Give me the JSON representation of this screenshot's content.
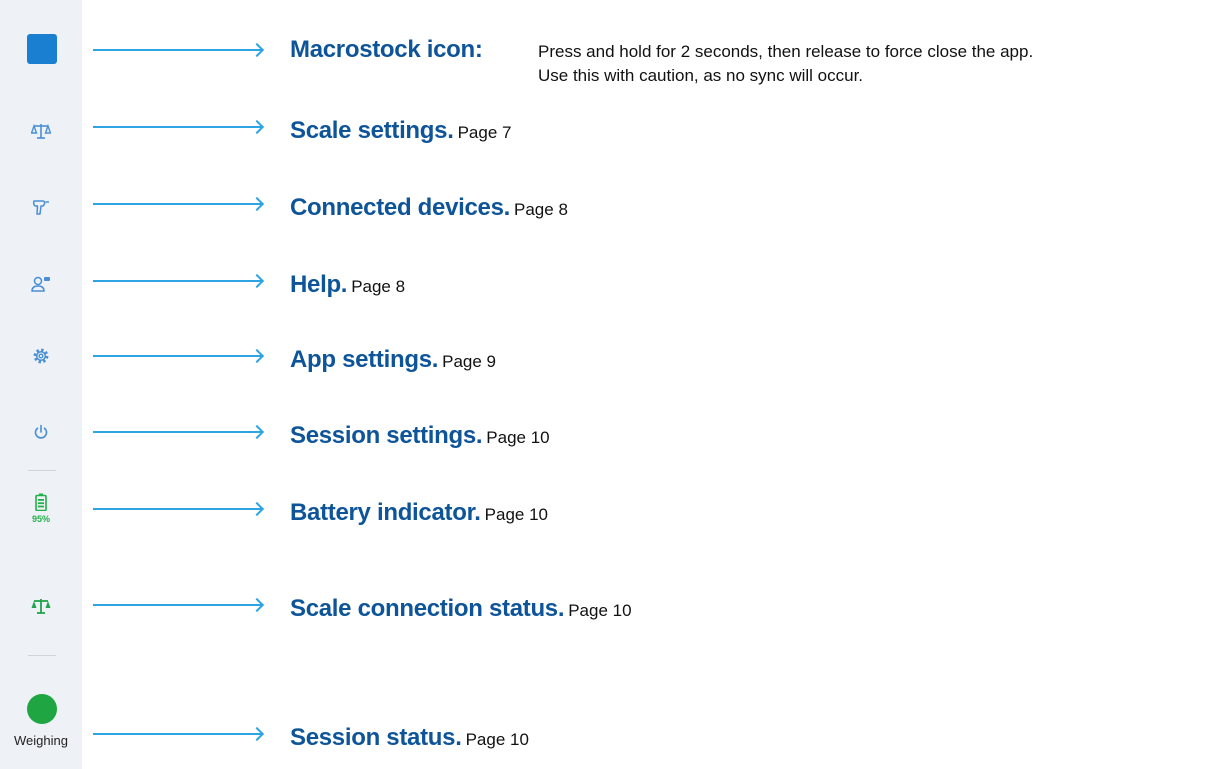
{
  "sidebar": {
    "battery_percent": "95%",
    "status_label": "Weighing",
    "icons": [
      "macrostock-icon",
      "scale-icon",
      "scanner-icon",
      "help-icon",
      "gear-icon",
      "power-icon",
      "battery-icon",
      "scale-status-icon",
      "status-dot-icon"
    ],
    "colors": {
      "background": "#eef1f5",
      "accent_blue": "#1a7fd1",
      "icon_blue": "#4a8fd6",
      "status_green": "#1fa541"
    }
  },
  "callouts": {
    "macrostock": {
      "title": "Macrostock icon:",
      "desc_line1": "Press and hold for 2 seconds, then release to force close the app.",
      "desc_line2": "Use this with caution, as no sync will occur."
    },
    "scale_settings": {
      "title": "Scale settings.",
      "page": "Page 7"
    },
    "connected_devices": {
      "title": "Connected devices.",
      "page": "Page 8"
    },
    "help": {
      "title": "Help.",
      "page": "Page 8"
    },
    "app_settings": {
      "title": "App settings.",
      "page": "Page 9"
    },
    "session_settings": {
      "title": "Session settings.",
      "page": "Page 10"
    },
    "battery": {
      "title": "Battery indicator.",
      "page": "Page 10"
    },
    "scale_connection": {
      "title": "Scale connection status.",
      "page": "Page 10"
    },
    "session_status": {
      "title": "Session status.",
      "page": "Page 10"
    }
  },
  "colors": {
    "title": "#0e5499",
    "arrow": "#2ea4e2",
    "text": "#111111"
  }
}
